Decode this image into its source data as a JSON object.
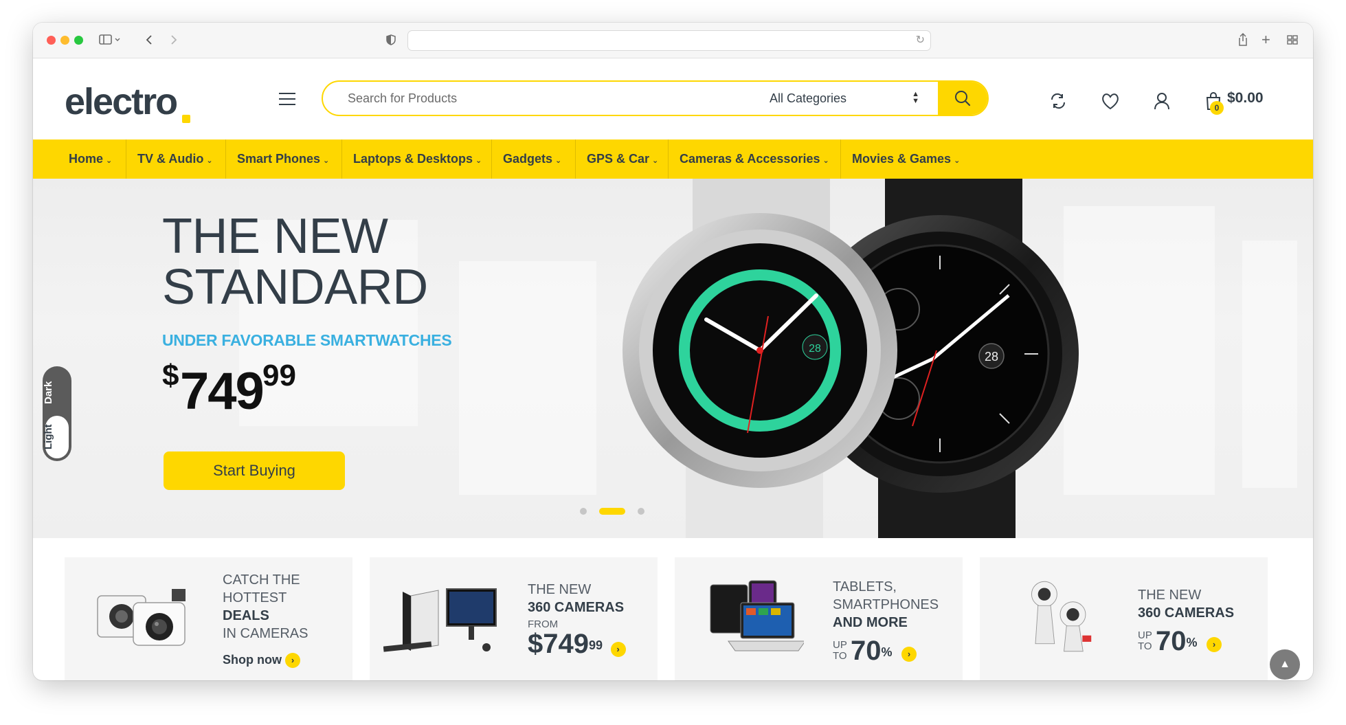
{
  "header": {
    "logo_text": "electro",
    "search_placeholder": "Search for Products",
    "category_select": "All Categories",
    "cart_amount": "$0.00",
    "cart_count": "0"
  },
  "nav": {
    "items": [
      {
        "label": "Home"
      },
      {
        "label": "TV & Audio"
      },
      {
        "label": "Smart Phones"
      },
      {
        "label": "Laptops & Desktops"
      },
      {
        "label": "Gadgets"
      },
      {
        "label": "GPS & Car"
      },
      {
        "label": "Cameras & Accessories"
      },
      {
        "label": "Movies & Games"
      }
    ]
  },
  "hero": {
    "title_line1": "THE NEW",
    "title_line2": "STANDARD",
    "subtitle": "UNDER FAVORABLE SMARTWATCHES",
    "price_currency": "$",
    "price_int": "749",
    "price_dec": "99",
    "button_label": "Start Buying",
    "watch_date_1": "28",
    "watch_date_2": "28",
    "slides_total": 3,
    "active_slide": 2
  },
  "theme_toggle": {
    "dark_label": "Dark",
    "light_label": "Light"
  },
  "promos": [
    {
      "line1": "CATCH THE",
      "line2": "HOTTEST",
      "line3": "DEALS",
      "line4": "IN CAMERAS",
      "cta": "Shop now"
    },
    {
      "line1": "THE NEW",
      "line2": "360 CAMERAS",
      "from": "FROM",
      "price_currency": "$",
      "price_int": "749",
      "price_dec": "99"
    },
    {
      "line1": "TABLETS,",
      "line2": "SMARTPHONES",
      "line3": "AND MORE",
      "up": "UP",
      "to": "TO",
      "percent_value": "70",
      "percent_sign": "%"
    },
    {
      "line1": "THE NEW",
      "line2": "360 CAMERAS",
      "up": "UP",
      "to": "TO",
      "percent_value": "70",
      "percent_sign": "%"
    }
  ],
  "colors": {
    "accent_yellow": "#fed700",
    "text_dark": "#333e48",
    "subtitle_blue": "#3ab0e0"
  }
}
